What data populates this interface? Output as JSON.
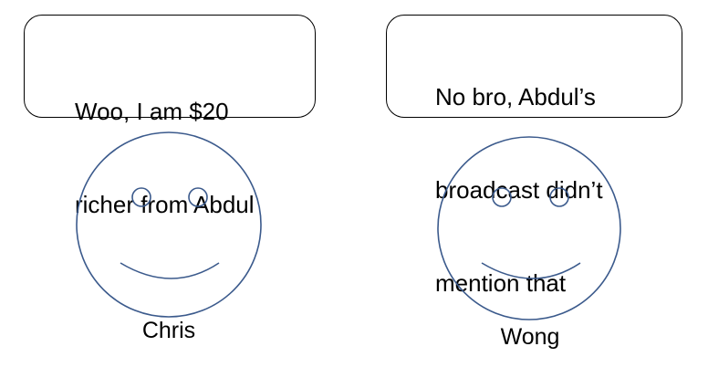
{
  "characters": [
    {
      "name": "Chris",
      "speech_lines": [
        "Woo, I am $20",
        "richer from Abdul"
      ]
    },
    {
      "name": "Wong",
      "speech_lines": [
        "No bro, Abdul’s",
        "broadcast didn’t",
        "mention that"
      ]
    }
  ],
  "colors": {
    "face_stroke": "#3b5a8c",
    "bubble_stroke": "#000000",
    "text": "#000000"
  }
}
